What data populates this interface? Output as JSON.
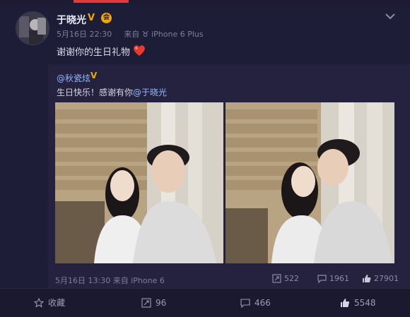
{
  "post": {
    "username": "于晓光",
    "verified_mark": "V",
    "member_badge": "会",
    "date": "5月16日 22:30",
    "source_prefix": "来自",
    "device": "iPhone 6 Plus",
    "text": "谢谢你的生日礼物",
    "heart_icon": "heart-icon"
  },
  "quoted": {
    "username": "@秋瓷炫",
    "verified_mark": "V",
    "text_before": "生日快乐！感谢有你",
    "mention": "@于晓光",
    "date": "5月16日 13:30",
    "source_prefix": "来自",
    "device": "iPhone 6",
    "reposts": "522",
    "comments": "1961",
    "likes": "27901"
  },
  "actions": {
    "favorite": "收藏",
    "repost": "96",
    "comment": "466",
    "like": "5548"
  },
  "colors": {
    "background": "#15142a",
    "card": "#1e1d38",
    "quoted_card": "#24223f",
    "link": "#8fb8ff",
    "badge": "#f2a800",
    "accent": "#e03a3a"
  }
}
